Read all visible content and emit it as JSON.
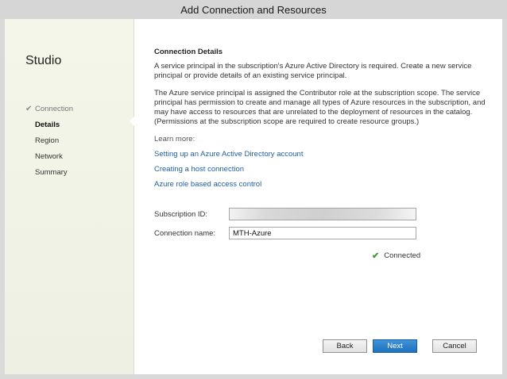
{
  "window": {
    "title": "Add Connection and Resources"
  },
  "sidebar": {
    "title": "Studio",
    "steps": [
      {
        "label": "Connection",
        "state": "done"
      },
      {
        "label": "Details",
        "state": "active"
      },
      {
        "label": "Region",
        "state": "pending"
      },
      {
        "label": "Network",
        "state": "pending"
      },
      {
        "label": "Summary",
        "state": "pending"
      }
    ]
  },
  "main": {
    "section_title": "Connection Details",
    "paragraph1": "A service principal in the subscription's Azure Active Directory is required. Create a new service principal or provide details of an existing service principal.",
    "paragraph2": "The Azure service principal is assigned the Contributor role at the subscription scope. The service principal has permission to create and manage all types of Azure resources in the subscription, and may have access to resources that are unrelated to the deployment of resources in the catalog. (Permissions at the subscription scope are required to create resource groups.)",
    "learn_more": "Learn more:",
    "links": [
      "Setting up an Azure Active Directory account",
      "Creating a host connection",
      "Azure role based access control"
    ],
    "subscription_id_label": "Subscription ID:",
    "subscription_id_value": "",
    "connection_name_label": "Connection name:",
    "connection_name_value": "MTH-Azure",
    "status_text": "Connected"
  },
  "buttons": {
    "back": "Back",
    "next": "Next",
    "cancel": "Cancel"
  },
  "colors": {
    "link": "#1f5fa8",
    "primary_button": "#2a7fc9",
    "success": "#3a9a2a"
  }
}
